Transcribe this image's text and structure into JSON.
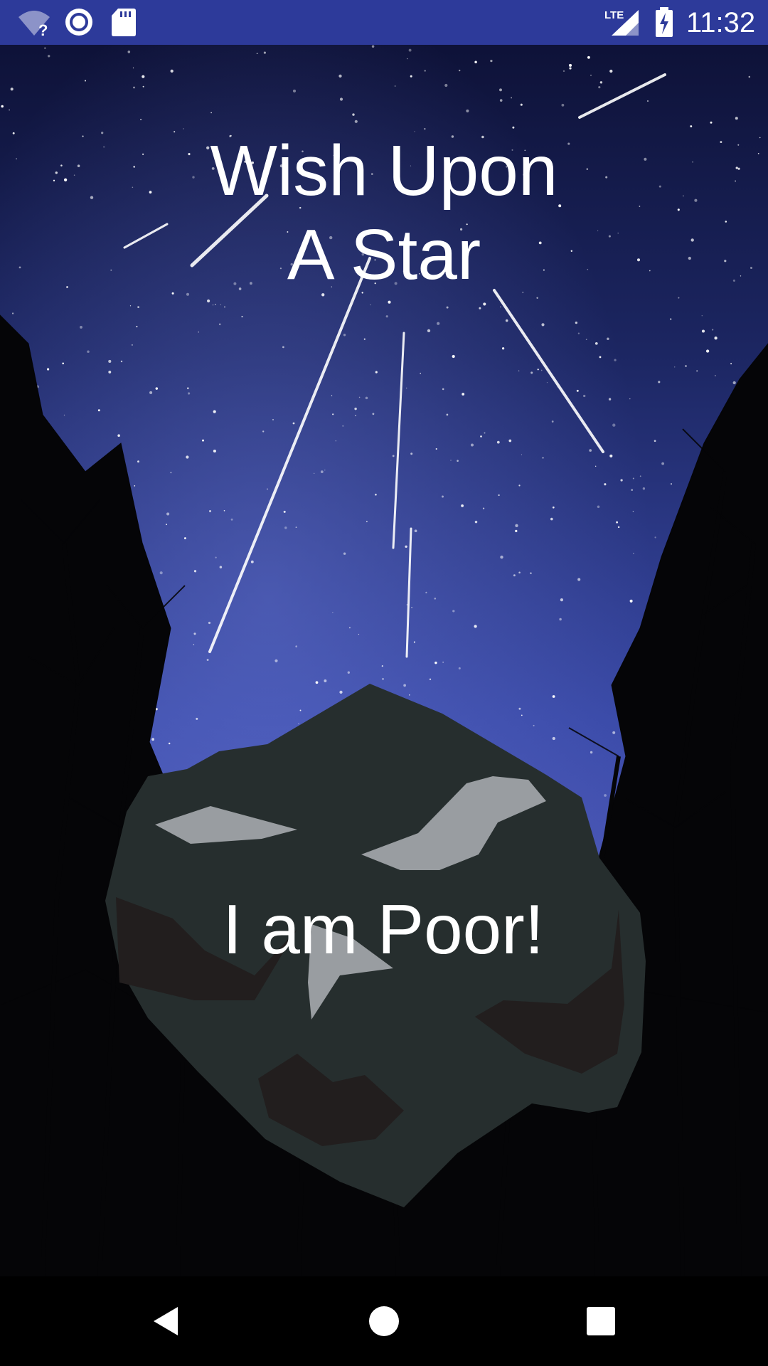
{
  "status_bar": {
    "time": "11:32",
    "network": "LTE",
    "icons": [
      "wifi-unknown-icon",
      "vpn-icon",
      "sd-card-icon",
      "lte-signal-icon",
      "battery-charging-icon"
    ],
    "background_color": "#2d3a9a"
  },
  "main": {
    "title_line1": "Wish Upon",
    "title_line2": "A Star",
    "button_label": "I am Poor!",
    "background": "night-sky-shooting-stars",
    "rock_color": "#262e2e"
  },
  "nav_bar": {
    "buttons": [
      "back-icon",
      "home-icon",
      "recents-icon"
    ]
  }
}
